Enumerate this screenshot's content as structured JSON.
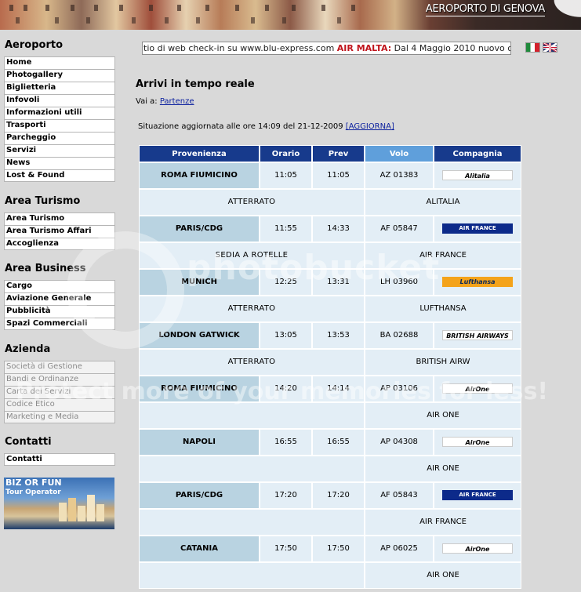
{
  "header": {
    "title": "AEROPORTO DI GENOVA"
  },
  "sidebar": {
    "sections": [
      {
        "title": "Aeroporto",
        "items": [
          "Home",
          "Photogallery",
          "Biglietteria",
          "Infovoli",
          "Informazioni utili",
          "Trasporti",
          "Parcheggio",
          "Servizi",
          "News",
          "Lost & Found"
        ]
      },
      {
        "title": "Area Turismo",
        "items": [
          "Area Turismo",
          "Area Turismo Affari",
          "Accoglienza"
        ]
      },
      {
        "title": "Area Business",
        "items": [
          "Cargo",
          "Aviazione Generale",
          "Pubblicità",
          "Spazi Commerciali"
        ]
      },
      {
        "title": "Azienda",
        "items": [
          "Società di Gestione",
          "Bandi e Ordinanze",
          "Carta dei Servizi",
          "Codice Etico",
          "Marketing e Media"
        ]
      },
      {
        "title": "Contatti",
        "items": [
          "Contatti"
        ]
      }
    ],
    "promo": {
      "line1": "BIZ OR FUN",
      "line2": "Tour Operator"
    }
  },
  "ticker": {
    "text_before": "tio di web check-in su www.blu-express.com ",
    "highlight": "AIR MALTA:",
    "text_after": " Dal 4 Maggio 2010 nuovo co"
  },
  "flags": {
    "it": "it-flag-icon",
    "uk": "uk-flag-icon"
  },
  "main": {
    "title": "Arrivi in tempo reale",
    "vai_label": "Vai a:",
    "vai_link": "Partenze",
    "update_text": "Situazione aggiornata alle ore 14:09 del 21-12-2009",
    "update_link": "[AGGIORNA]"
  },
  "table": {
    "headers": [
      "Provenienza",
      "Orario",
      "Prev",
      "Volo",
      "Compagnia"
    ],
    "flights": [
      {
        "provenienza": "ROMA FIUMICINO",
        "orario": "11:05",
        "prev": "11:05",
        "volo": "AZ 01383",
        "logo": "Alitalia",
        "logo_style": "white",
        "status": "ATTERRATO",
        "compagnia": "ALITALIA"
      },
      {
        "provenienza": "PARIS/CDG",
        "orario": "11:55",
        "prev": "14:33",
        "volo": "AF 05847",
        "logo": "AIR FRANCE",
        "logo_style": "af",
        "status": "SEDIA A ROTELLE",
        "compagnia": "AIR FRANCE"
      },
      {
        "provenienza": "MUNICH",
        "orario": "12:25",
        "prev": "13:31",
        "volo": "LH 03960",
        "logo": "Lufthansa",
        "logo_style": "lh",
        "status": "ATTERRATO",
        "compagnia": "LUFTHANSA"
      },
      {
        "provenienza": "LONDON GATWICK",
        "orario": "13:05",
        "prev": "13:53",
        "volo": "BA 02688",
        "logo": "BRITISH AIRWAYS",
        "logo_style": "white",
        "status": "ATTERRATO",
        "compagnia": "BRITISH AIRW"
      },
      {
        "provenienza": "ROMA FIUMICINO",
        "orario": "14:20",
        "prev": "14:14",
        "volo": "AP 03106",
        "logo": "AirOne",
        "logo_style": "white",
        "status": "",
        "compagnia": "AIR ONE"
      },
      {
        "provenienza": "NAPOLI",
        "orario": "16:55",
        "prev": "16:55",
        "volo": "AP 04308",
        "logo": "AirOne",
        "logo_style": "white",
        "status": "",
        "compagnia": "AIR ONE"
      },
      {
        "provenienza": "PARIS/CDG",
        "orario": "17:20",
        "prev": "17:20",
        "volo": "AF 05843",
        "logo": "AIR FRANCE",
        "logo_style": "af",
        "status": "",
        "compagnia": "AIR FRANCE"
      },
      {
        "provenienza": "CATANIA",
        "orario": "17:50",
        "prev": "17:50",
        "volo": "AP 06025",
        "logo": "AirOne",
        "logo_style": "white",
        "status": "",
        "compagnia": "AIR ONE"
      }
    ]
  },
  "watermark": {
    "line1": "photobucket",
    "line2": "Protect more of your memories for less!"
  }
}
